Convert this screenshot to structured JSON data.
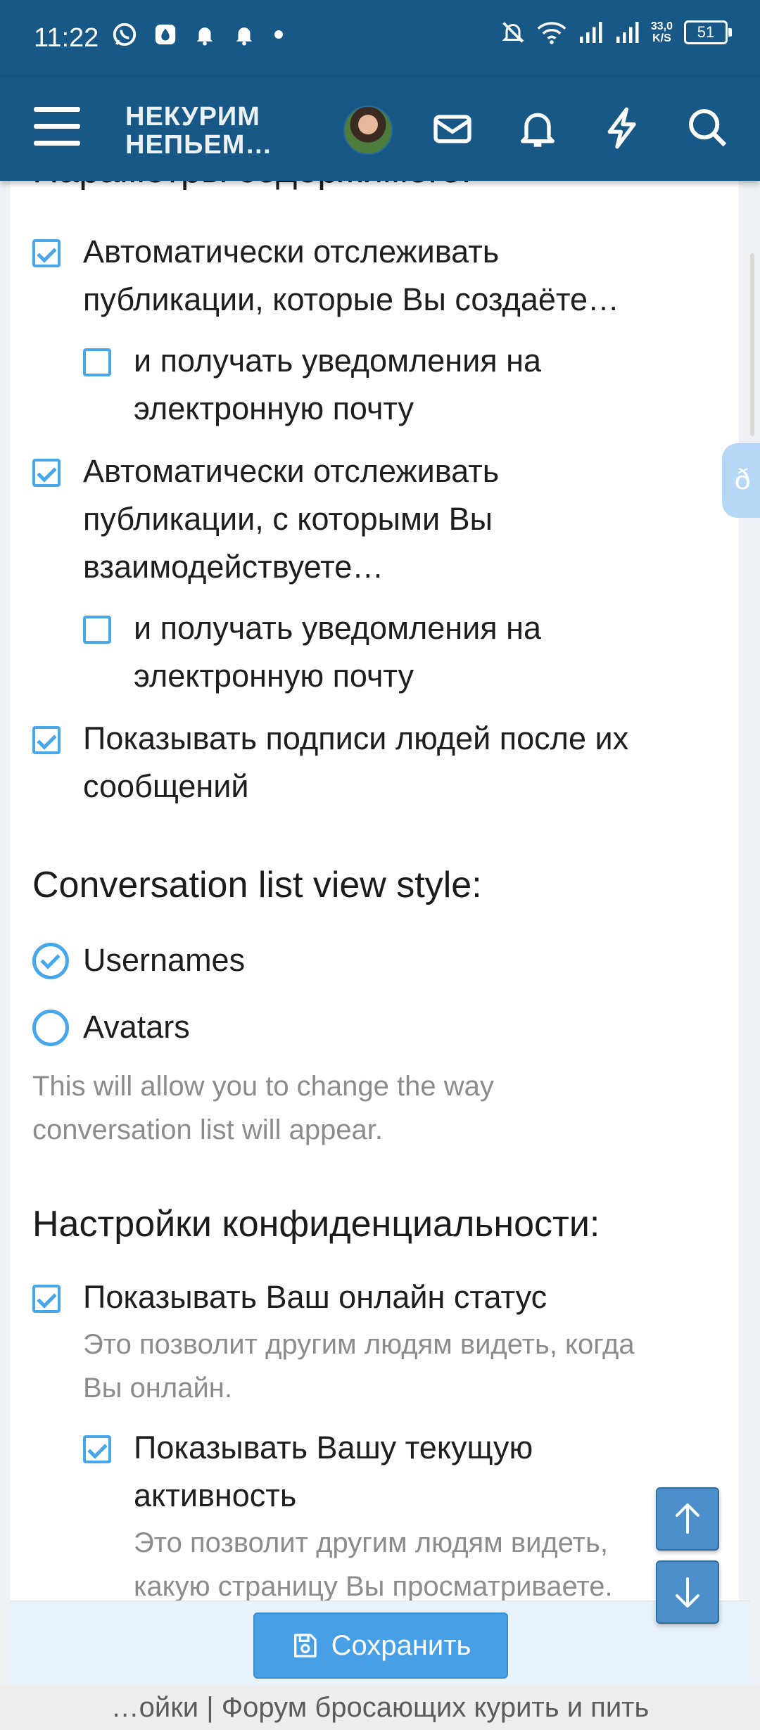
{
  "status_bar": {
    "time": "11:22",
    "speed_value": "33,0",
    "speed_unit": "K/S",
    "battery": "51"
  },
  "header": {
    "logo_line1": "НЕКУРИМ",
    "logo_line2": "НЕПЬЕМ…"
  },
  "content": {
    "section_content_title": "Параметры содержимого:",
    "options": [
      {
        "label_l1": "Автоматически отслеживать",
        "label_l2": "публикации, которые Вы создаёте…",
        "checked": true
      },
      {
        "label_l1": "и получать уведомления на",
        "label_l2": "электронную почту",
        "checked": false
      },
      {
        "label_l1": "Автоматически отслеживать",
        "label_l2": "публикации, с которыми Вы",
        "label_l3": "взаимодействуете…",
        "checked": true
      },
      {
        "label_l1": "и получать уведомления на",
        "label_l2": "электронную почту",
        "checked": false
      },
      {
        "label_l1": "Показывать подписи людей после их",
        "label_l2": "сообщений",
        "checked": true
      }
    ],
    "conversation_title": "Conversation list view style:",
    "conversation_options": [
      {
        "label": "Usernames",
        "selected": true
      },
      {
        "label": "Avatars",
        "selected": false
      }
    ],
    "conversation_hint_l1": "This will allow you to change the way",
    "conversation_hint_l2": "conversation list will appear.",
    "privacy_title": "Настройки конфиденциальности:",
    "online_status_label": "Показывать Ваш онлайн статус",
    "online_status_hint_l1": "Это позволит другим людям видеть, когда",
    "online_status_hint_l2": "Вы онлайн.",
    "activity_label_l1": "Показывать Вашу текущую",
    "activity_label_l2": "активность",
    "activity_hint_l1": "Это позволит другим людям видеть,",
    "activity_hint_l2": "какую страницу Вы просматриваете."
  },
  "footer": {
    "save_label": "Сохранить",
    "page_title": "…ойки | Форум бросающих курить и пить"
  },
  "colors": {
    "header_bg": "#185886",
    "accent": "#47a7eb",
    "save_button": "#47a0e6"
  }
}
